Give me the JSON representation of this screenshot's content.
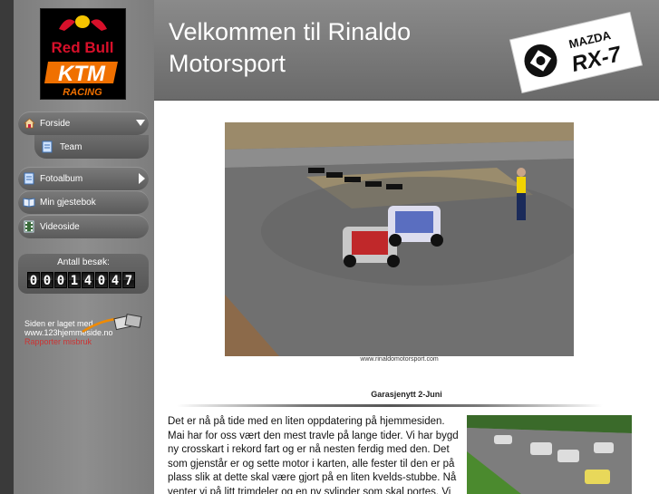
{
  "header": {
    "title": "Velkommen til Rinaldo Motorsport"
  },
  "logos": {
    "sidebar_brand": "Red Bull KTM Racing",
    "sidebar_brand_line1": "Red Bull",
    "sidebar_brand_line2": "KTM",
    "sidebar_brand_line3": "RACING",
    "header_badge_line1": "MAZDA",
    "header_badge_line2": "RX-7"
  },
  "nav": {
    "items": [
      {
        "label": "Forside",
        "icon": "home-icon"
      },
      {
        "label": "Team",
        "icon": "page-icon"
      },
      {
        "label": "Fotoalbum",
        "icon": "page-icon"
      },
      {
        "label": "Min gjestebok",
        "icon": "book-icon"
      },
      {
        "label": "Videoside",
        "icon": "film-icon"
      }
    ]
  },
  "counter": {
    "label": "Antall besøk:",
    "digits": [
      "0",
      "0",
      "0",
      "1",
      "4",
      "0",
      "4",
      "7"
    ]
  },
  "footer_badge": {
    "line1": "Siden er laget med",
    "line2": "www.123hjemmeside.no",
    "line3": "Rapporter misbruk"
  },
  "content": {
    "photo_caption": "www.rinaldomotorsport.com",
    "section_title": "Garasjenytt 2-Juni",
    "paragraph": "Det er nå på tide med en liten oppdatering på hjemmesiden. Mai har for oss vært den mest travle på lange tider. Vi har bygd ny crosskart i rekord fart og er nå nesten ferdig med den. Det som gjenstår er og sette motor i karten, alle fester til den er på plass slik at dette skal være gjort på en liten kvelds-stubbe. Nå venter vi på litt trimdeler og en ny sylinder som skal portes. Vi må prøve"
  },
  "colors": {
    "sidebar": "#8a8a8a",
    "header": "#777777",
    "nav_bg": "#666666",
    "background": "#3a3a3a",
    "main_bg": "#ffffff"
  }
}
